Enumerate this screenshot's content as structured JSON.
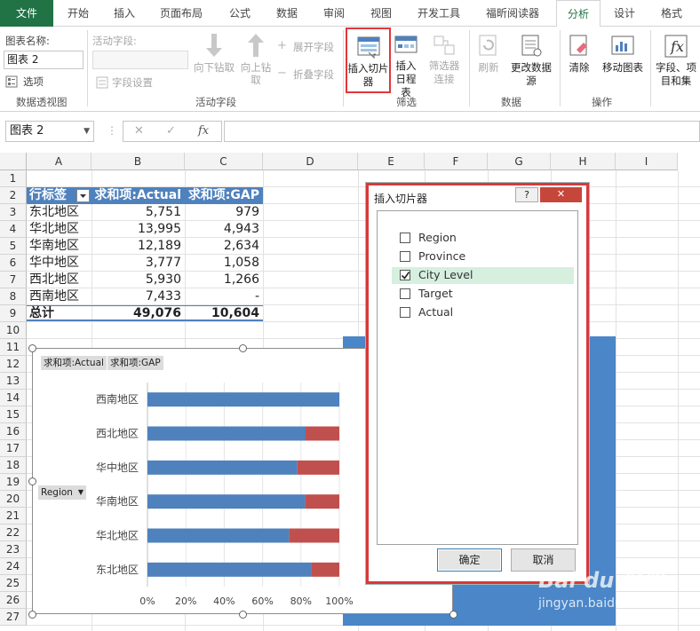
{
  "tabs": [
    "文件",
    "开始",
    "插入",
    "页面布局",
    "公式",
    "数据",
    "审阅",
    "视图",
    "开发工具",
    "福昕阅读器",
    "分析",
    "设计",
    "格式"
  ],
  "ribbon": {
    "pivot_name_label": "图表名称:",
    "pivot_name_value": "图表 2",
    "options_label": "选项",
    "group_pivot": "数据透视图",
    "active_field_label": "活动字段:",
    "field_settings_label": "字段设置",
    "drill_down_label": "向下钻取",
    "drill_up_label": "向上钻取",
    "expand_label": "展开字段",
    "collapse_label": "折叠字段",
    "group_active_field": "活动字段",
    "insert_slicer_label": "插入切片器",
    "insert_timeline_label": "插入日程表",
    "filter_connections_label": "筛选器连接",
    "group_filter": "筛选",
    "refresh_label": "刷新",
    "change_source_label": "更改数据源",
    "group_data": "数据",
    "clear_label": "清除",
    "move_chart_label": "移动图表",
    "group_actions": "操作",
    "fields_label": "字段、项目和集"
  },
  "formula_bar": {
    "name_box": "图表 2",
    "cancel": "✕",
    "enter": "✓",
    "fx": "fx"
  },
  "columns": [
    "A",
    "B",
    "C",
    "D",
    "E",
    "F",
    "G",
    "H",
    "I"
  ],
  "rows": [
    "1",
    "2",
    "3",
    "4",
    "5",
    "6",
    "7",
    "8",
    "9",
    "10",
    "11",
    "12",
    "13",
    "14",
    "15",
    "16",
    "17",
    "18",
    "19",
    "20",
    "21",
    "22",
    "23",
    "24",
    "25",
    "26",
    "27"
  ],
  "pivot_table": {
    "headers": [
      "行标签",
      "求和项:Actual",
      "求和项:GAP"
    ],
    "rows": [
      {
        "label": "东北地区",
        "actual": "5,751",
        "gap": "979"
      },
      {
        "label": "华北地区",
        "actual": "13,995",
        "gap": "4,943"
      },
      {
        "label": "华南地区",
        "actual": "12,189",
        "gap": "2,634"
      },
      {
        "label": "华中地区",
        "actual": "3,777",
        "gap": "1,058"
      },
      {
        "label": "西北地区",
        "actual": "5,930",
        "gap": "1,266"
      },
      {
        "label": "西南地区",
        "actual": "7,433",
        "gap": "-"
      }
    ],
    "total": {
      "label": "总计",
      "actual": "49,076",
      "gap": "10,604"
    }
  },
  "chart_buttons": {
    "actual": "求和项:Actual",
    "gap": "求和项:GAP",
    "region": "Region"
  },
  "chart_data": {
    "type": "bar",
    "stacked": "percent",
    "orientation": "horizontal",
    "categories": [
      "东北地区",
      "华北地区",
      "华南地区",
      "华中地区",
      "西北地区",
      "西南地区"
    ],
    "series": [
      {
        "name": "求和项:Actual",
        "values": [
          5751,
          13995,
          12189,
          3777,
          5930,
          7433
        ],
        "color": "#4f81bd"
      },
      {
        "name": "求和项:GAP",
        "values": [
          979,
          4943,
          2634,
          1058,
          1266,
          0
        ],
        "color": "#c0504d"
      }
    ],
    "x_ticks": [
      "0%",
      "20%",
      "40%",
      "60%",
      "80%",
      "100%"
    ],
    "xlim": [
      0,
      1
    ]
  },
  "dialog": {
    "title": "插入切片器",
    "help": "?",
    "close": "✕",
    "fields": [
      {
        "label": "Region",
        "checked": false
      },
      {
        "label": "Province",
        "checked": false
      },
      {
        "label": "City Level",
        "checked": true
      },
      {
        "label": "Target",
        "checked": false
      },
      {
        "label": "Actual",
        "checked": false
      }
    ],
    "ok": "确定",
    "cancel": "取消"
  },
  "watermark": {
    "line1": "Bai du 经验",
    "line2": "jingyan.baidu.com"
  }
}
